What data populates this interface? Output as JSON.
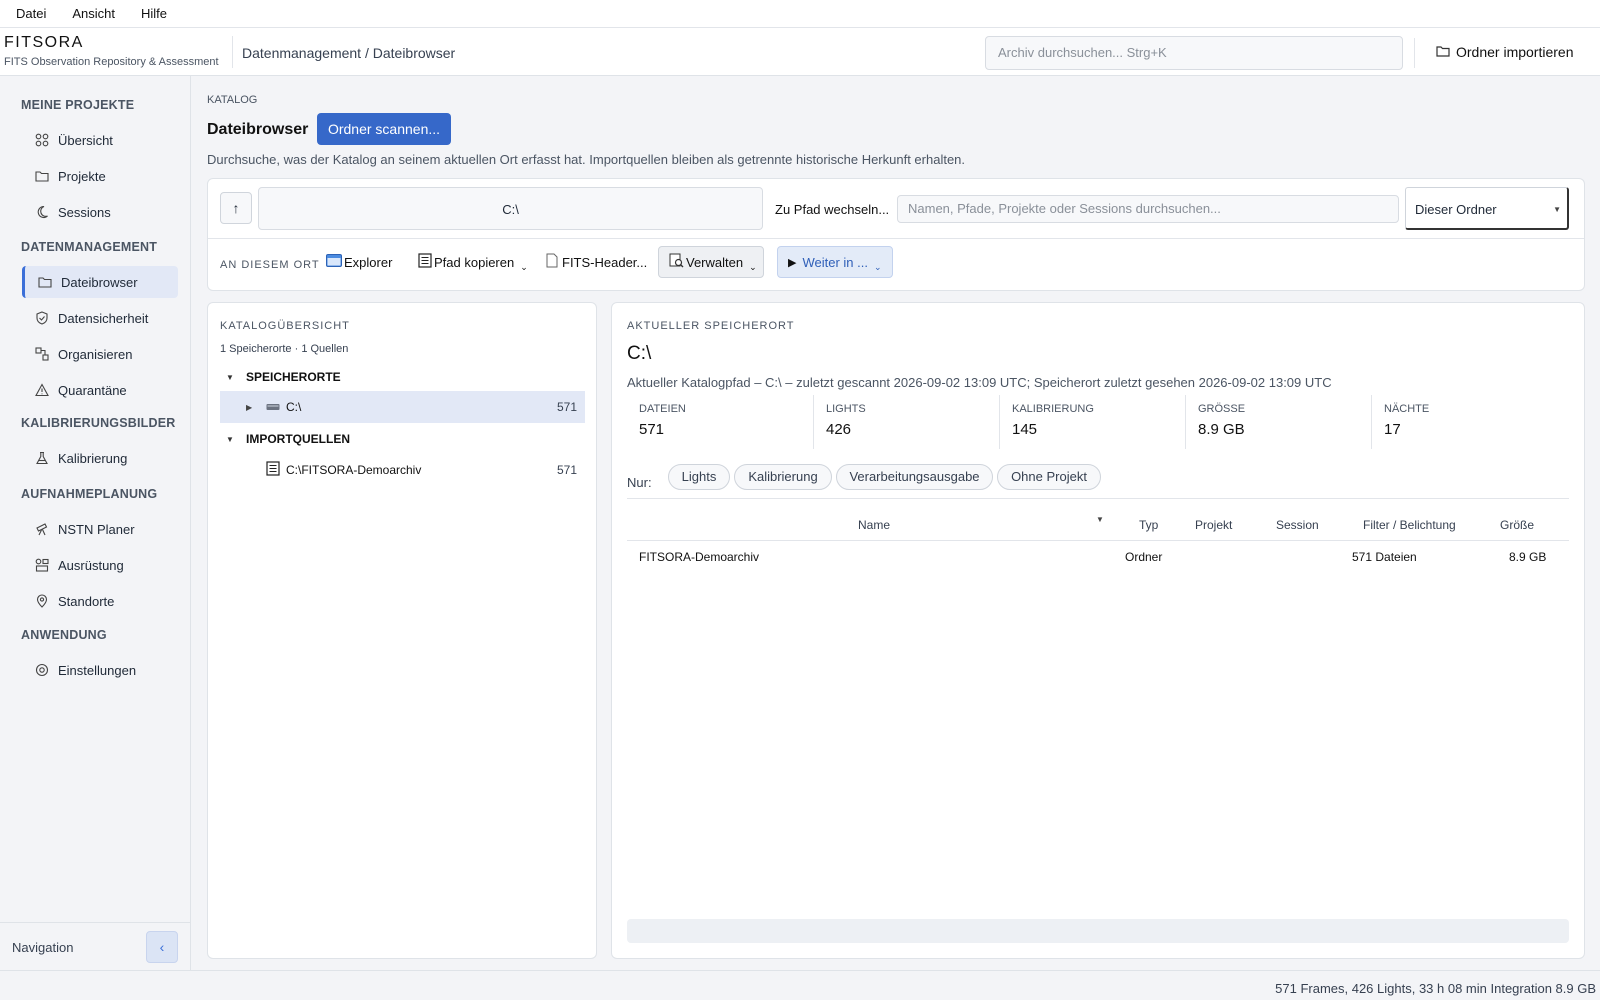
{
  "menubar": {
    "items": [
      "Datei",
      "Ansicht",
      "Hilfe"
    ]
  },
  "header": {
    "brand": "FITSORA",
    "brand_sub": "FITS Observation Repository & Assessment",
    "breadcrumb": "Datenmanagement / Dateibrowser",
    "search_placeholder": "Archiv durchsuchen...  Strg+K",
    "import_label": "Ordner importieren"
  },
  "sidebar": {
    "sections": [
      "MEINE PROJEKTE",
      "DATENMANAGEMENT",
      "KALIBRIERUNGSBILDER",
      "AUFNAHMEPLANUNG",
      "ANWENDUNG"
    ],
    "items": [
      {
        "label": "Übersicht",
        "icon": "grid-icon"
      },
      {
        "label": "Projekte",
        "icon": "folder-icon"
      },
      {
        "label": "Sessions",
        "icon": "moon-icon"
      },
      {
        "label": "Dateibrowser",
        "icon": "folder-icon"
      },
      {
        "label": "Datensicherheit",
        "icon": "shield-icon"
      },
      {
        "label": "Organisieren",
        "icon": "organize-icon"
      },
      {
        "label": "Quarantäne",
        "icon": "warning-icon"
      },
      {
        "label": "Kalibrierung",
        "icon": "flask-icon"
      },
      {
        "label": "NSTN Planer",
        "icon": "telescope-icon"
      },
      {
        "label": "Ausrüstung",
        "icon": "equipment-icon"
      },
      {
        "label": "Standorte",
        "icon": "location-pin-icon"
      },
      {
        "label": "Einstellungen",
        "icon": "gear-icon"
      }
    ],
    "footer_label": "Navigation",
    "collapse_symbol": "‹"
  },
  "main": {
    "section_label": "KATALOG",
    "title": "Dateibrowser",
    "scan_button": "Ordner scannen...",
    "description": "Durchsuche, was der Katalog an seinem aktuellen Ort erfasst hat. Importquellen bleiben als getrennte historische Herkunft erhalten."
  },
  "toolbar": {
    "up_symbol": "↑",
    "path": "C:\\",
    "goto_label": "Zu Pfad wechseln...",
    "filter_placeholder": "Namen, Pfade, Projekte oder Sessions durchsuchen...",
    "scope_value": "Dieser Ordner",
    "here_label": "AN DIESEM ORT",
    "actions": {
      "explorer": "Explorer",
      "copy_path": "Pfad kopieren",
      "fits_header": "FITS-Header...",
      "manage": "Verwalten",
      "continue_in": "Weiter in ..."
    }
  },
  "catalog": {
    "title": "KATALOGÜBERSICHT",
    "subtitle": "1 Speicherorte · 1 Quellen",
    "locations_heading": "SPEICHERORTE",
    "location": {
      "name": "C:\\",
      "count": "571"
    },
    "sources_heading": "IMPORTQUELLEN",
    "source": {
      "name": "C:\\FITSORA-Demoarchiv",
      "count": "571"
    }
  },
  "location": {
    "title": "AKTUELLER SPEICHERORT",
    "path": "C:\\",
    "info": "Aktueller Katalogpfad – C:\\ – zuletzt gescannt 2026-09-02 13:09 UTC; Speicherort zuletzt gesehen 2026-09-02 13:09 UTC",
    "stats": [
      {
        "label": "DATEIEN",
        "value": "571"
      },
      {
        "label": "LIGHTS",
        "value": "426"
      },
      {
        "label": "KALIBRIERUNG",
        "value": "145"
      },
      {
        "label": "GRÖSSE",
        "value": "8.9 GB"
      },
      {
        "label": "NÄCHTE",
        "value": "17"
      }
    ],
    "filter_label": "Nur:",
    "chips": [
      "Lights",
      "Kalibrierung",
      "Verarbeitungsausgabe",
      "Ohne Projekt"
    ],
    "columns": [
      "Name",
      "Typ",
      "Projekt",
      "Session",
      "Filter / Belichtung",
      "Größe"
    ],
    "rows": [
      {
        "name": "FITSORA-Demoarchiv",
        "type": "Ordner",
        "project": "",
        "session": "",
        "filter": "571 Dateien",
        "size": "8.9 GB"
      }
    ]
  },
  "status": {
    "text": "571 Frames, 426 Lights, 33 h 08 min Integration  8.9 GB"
  }
}
